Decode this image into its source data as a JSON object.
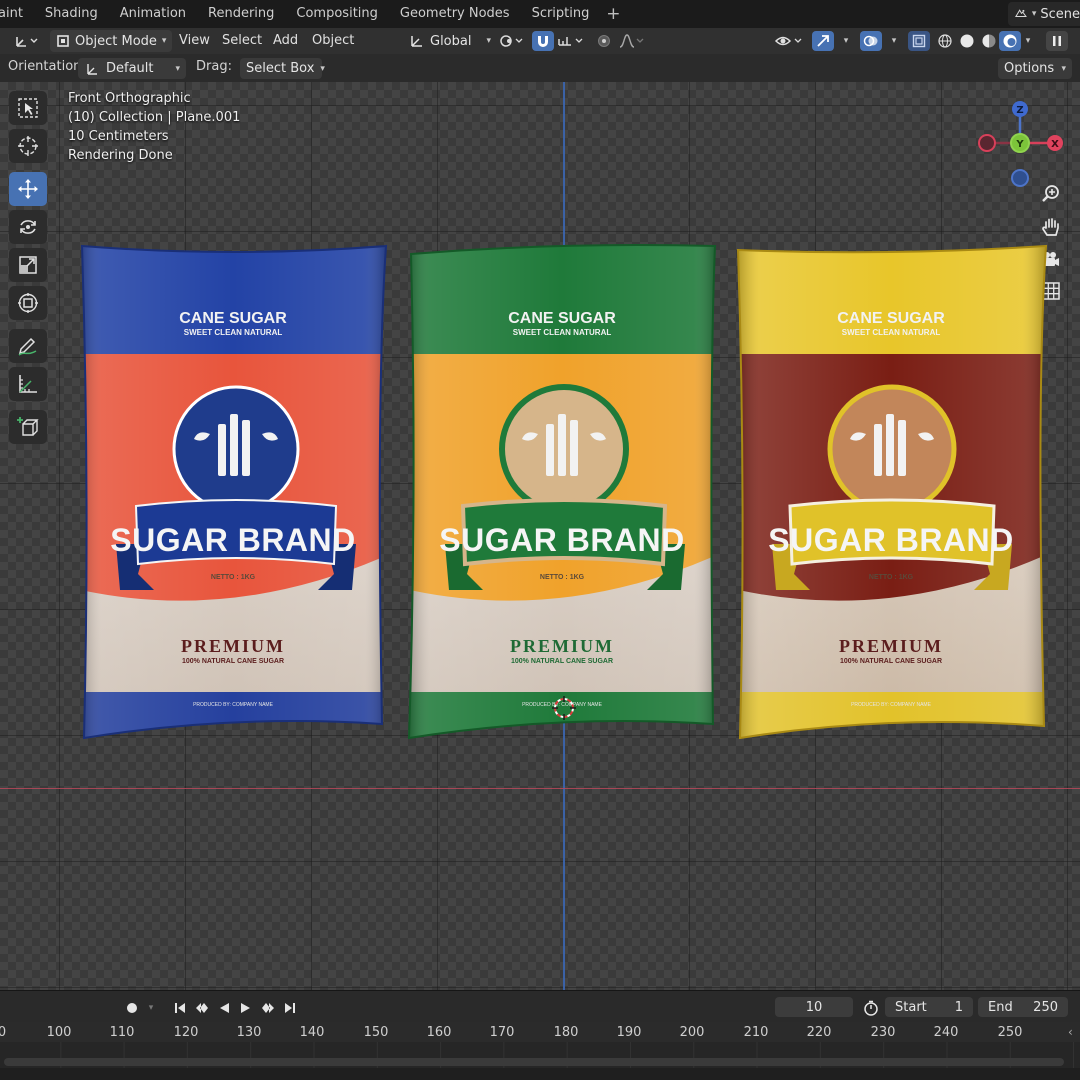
{
  "workspace_tabs": [
    "aint",
    "Shading",
    "Animation",
    "Rendering",
    "Compositing",
    "Geometry Nodes",
    "Scripting"
  ],
  "workspace_add": "+",
  "scene_label": "Scene",
  "header": {
    "mode": "Object Mode",
    "menus": [
      "View",
      "Select",
      "Add",
      "Object"
    ],
    "transform_orientation": "Global"
  },
  "tool_settings": {
    "orientation_label": "Orientation:",
    "orientation_value": "Default",
    "drag_label": "Drag:",
    "drag_value": "Select Box",
    "options_label": "Options"
  },
  "viewport_overlay": {
    "view_name": "Front Orthographic",
    "collection": "(10) Collection | Plane.001",
    "scale": "10 Centimeters",
    "status": "Rendering Done"
  },
  "gizmo": {
    "z": "Z",
    "y": "Y",
    "x": "X"
  },
  "bags": [
    {
      "variant": "blue",
      "top_text": "CANE SUGAR",
      "sub_text": "SWEET CLEAN NATURAL",
      "brand": "SUGAR BRAND",
      "netto": "NETTO : 1KG",
      "premium": "PREMIUM",
      "natural": "100% NATURAL CANE SUGAR",
      "producer": "PRODUCED BY: COMPANY NAME",
      "colors": {
        "top": "#2343a6",
        "mid": "#e8553c",
        "emblem": "#1f3c8c",
        "ribbon": "#1c3a94",
        "premium": "#5b1d1d",
        "bottom": "#25409e"
      }
    },
    {
      "variant": "green",
      "top_text": "CANE SUGAR",
      "sub_text": "SWEET CLEAN NATURAL",
      "brand": "SUGAR BRAND",
      "netto": "NETTO : 1KG",
      "premium": "PREMIUM",
      "natural": "100% NATURAL CANE SUGAR",
      "producer": "PRODUCED BY: COMPANY NAME",
      "colors": {
        "top": "#1f7a3a",
        "mid": "#f0a22b",
        "emblem": "#d6b58a",
        "ribbon": "#1f7a3a",
        "premium": "#1f6a35",
        "bottom": "#1f7a3a"
      }
    },
    {
      "variant": "yellow",
      "top_text": "CANE SUGAR",
      "sub_text": "SWEET CLEAN NATURAL",
      "brand": "SUGAR BRAND",
      "netto": "NETTO : 1KG",
      "premium": "PREMIUM",
      "natural": "100% NATURAL CANE SUGAR",
      "producer": "PRODUCED BY: COMPANY NAME",
      "colors": {
        "top": "#e8c62a",
        "mid": "#7a1e14",
        "emblem": "#c2865a",
        "ribbon": "#e0c229",
        "premium": "#5b1d1d",
        "bottom": "#e2c22a"
      }
    }
  ],
  "timeline": {
    "current_frame": "10",
    "start_label": "Start",
    "start_value": "1",
    "end_label": "End",
    "end_value": "250",
    "ruler": [
      "0",
      "100",
      "110",
      "120",
      "130",
      "140",
      "150",
      "160",
      "170",
      "180",
      "190",
      "200",
      "210",
      "220",
      "230",
      "240",
      "250"
    ]
  }
}
